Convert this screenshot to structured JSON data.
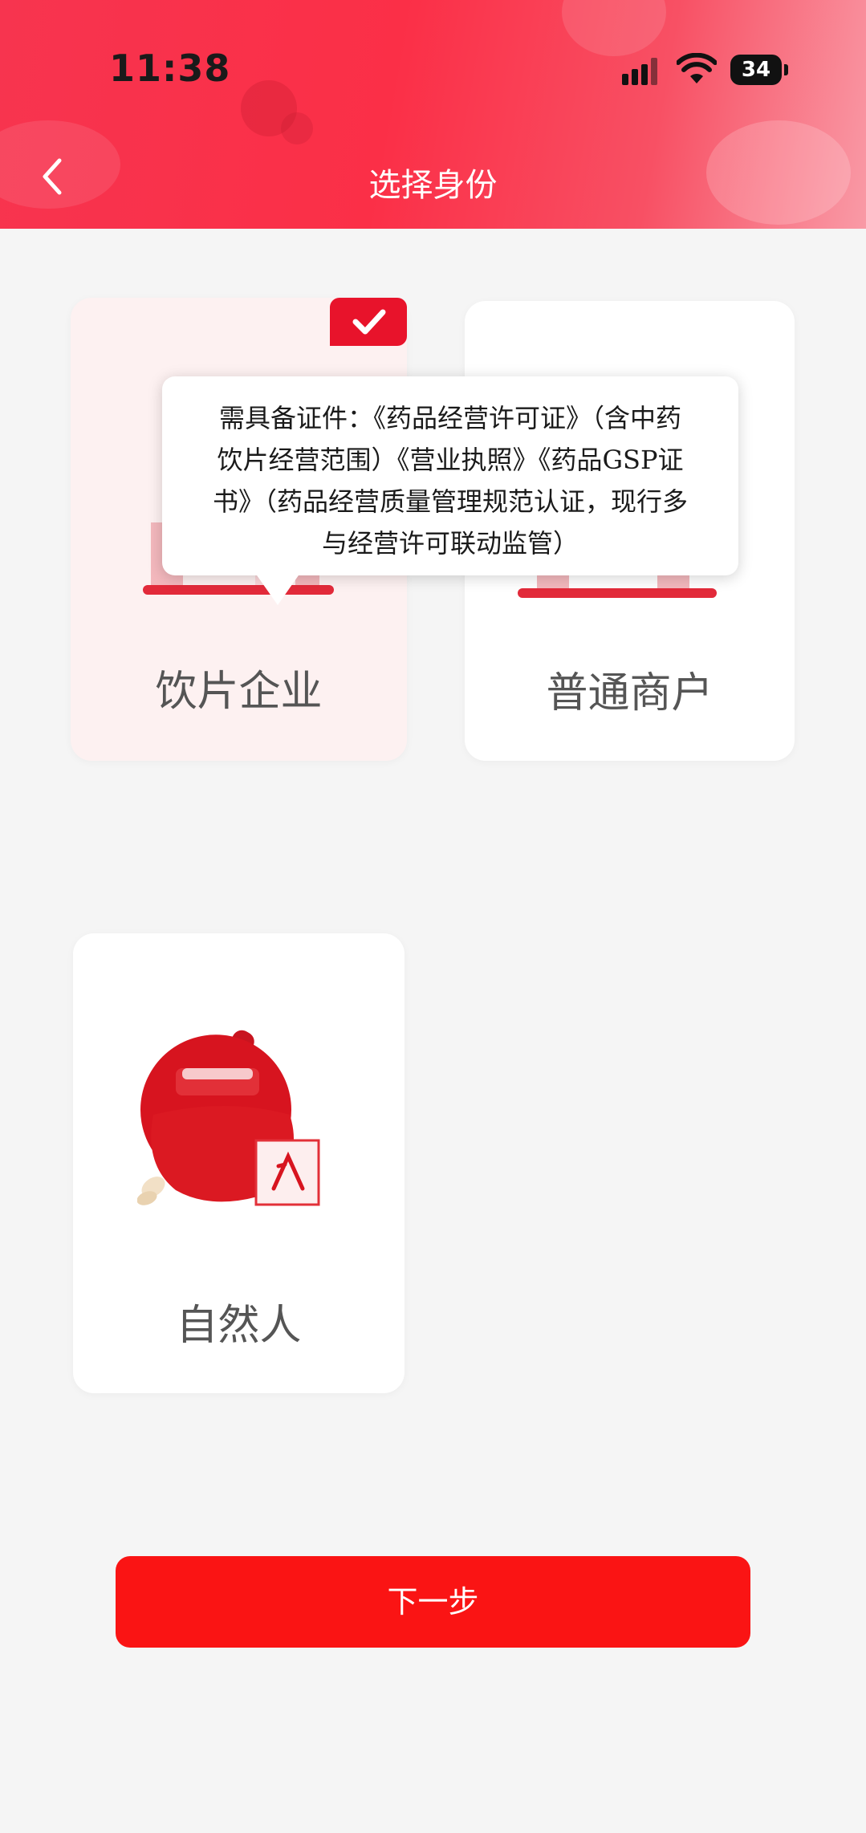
{
  "status_bar": {
    "time": "11:38",
    "battery": "34"
  },
  "header": {
    "title": "选择身份"
  },
  "cards": [
    {
      "label": "饮片企业",
      "selected": true
    },
    {
      "label": "普通商户",
      "selected": false
    },
    {
      "label": "自然人",
      "selected": false
    }
  ],
  "tooltip": {
    "line1": "需具备证件：《药品经营许可证》（含中药",
    "line2": "饮片经营范围）《营业执照》《药品GSP证",
    "line3": "书》（药品经营质量管理规范认证，现行多",
    "line4": "与经营许可联动监管）"
  },
  "footer": {
    "next_label": "下一步"
  },
  "colors": {
    "brand_red": "#e8132b",
    "button_red": "#fa1414"
  }
}
